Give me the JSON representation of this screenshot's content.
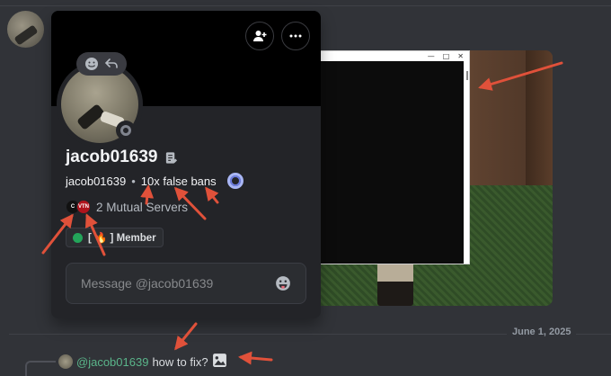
{
  "profile": {
    "display_name": "jacob01639",
    "username": "jacob01639",
    "separator": "•",
    "pronouns": "10x false bans",
    "mutual_servers": "2 Mutual Servers",
    "role": "[ 🔥 ] Member",
    "message_placeholder": "Message @jacob01639",
    "guild_icon_1": "C",
    "guild_icon_2": "VTN"
  },
  "icons": {
    "add_friend": "add-friend-icon",
    "more": "ellipsis-icon",
    "react": "smile-icon",
    "reply": "reply-icon",
    "note": "note-icon",
    "emoji": "emoji-icon",
    "image": "image-icon"
  },
  "chat": {
    "date_divider": "June 1, 2025",
    "reply_mention": "@jacob01639",
    "reply_text": "how to fix?"
  },
  "attachment": {
    "window_controls": [
      "—",
      "□",
      "✕"
    ]
  },
  "colors": {
    "background": "#313338",
    "popout": "#232428",
    "annotation": "#e0513a",
    "status_offline": "#80848e",
    "role_green": "#23a55a",
    "mention_green": "#5ab58a"
  }
}
